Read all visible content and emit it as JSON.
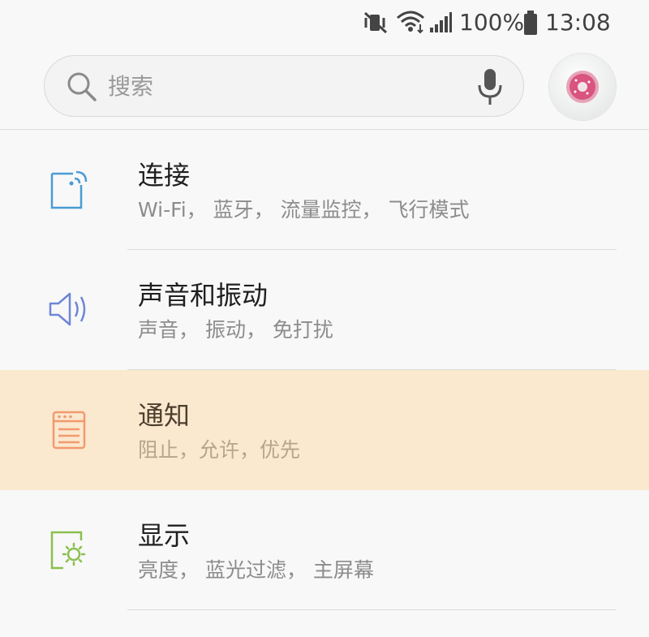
{
  "status_bar": {
    "icons": [
      "mute-vibrate-icon",
      "wifi-icon",
      "signal-icon",
      "battery-icon"
    ],
    "battery": "100%",
    "time": "13:08"
  },
  "search": {
    "placeholder": "搜索"
  },
  "settings": [
    {
      "title": "连接",
      "subtitle": "Wi-Fi， 蓝牙， 流量监控， 飞行模式",
      "icon": "connections-icon",
      "color": "#4a9bd4"
    },
    {
      "title": "声音和振动",
      "subtitle": "声音， 振动， 免打扰",
      "icon": "sound-icon",
      "color": "#6f86d6"
    },
    {
      "title": "通知",
      "subtitle": "阻止，允许，优先",
      "icon": "notification-icon",
      "color": "#f29a6e",
      "highlighted": true
    },
    {
      "title": "显示",
      "subtitle": "亮度， 蓝光过滤， 主屏幕",
      "icon": "display-icon",
      "color": "#8bbf4e"
    }
  ],
  "colors": {
    "background": "#f8f8f8",
    "highlight": "#fae8cf"
  }
}
